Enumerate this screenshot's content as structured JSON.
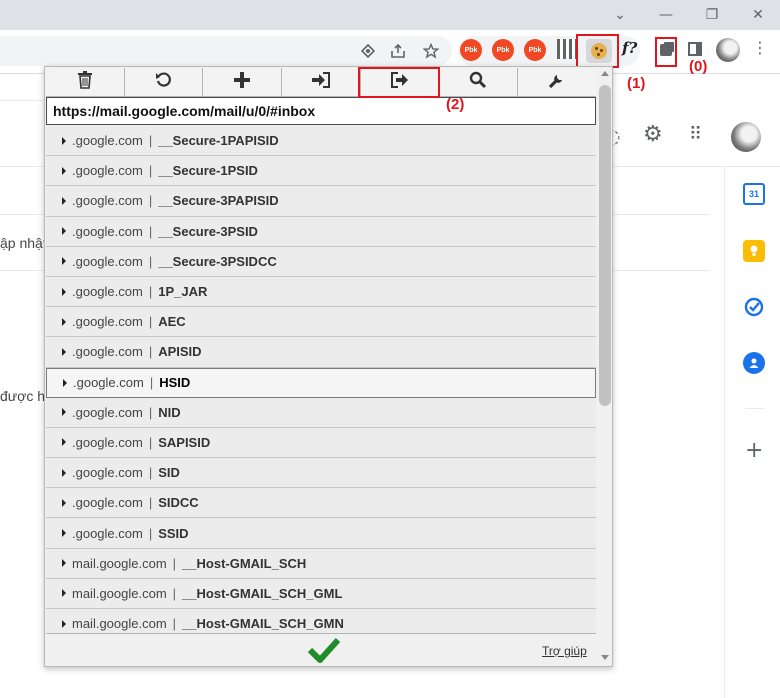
{
  "window_controls": {
    "tab_search": "⌄",
    "minimize": "—",
    "restore": "❐",
    "close": "✕"
  },
  "toolbar": {
    "extensions": [
      "Pbk",
      "Pbk",
      "Pbk"
    ],
    "fx_label": "f?",
    "more": "⋮"
  },
  "annotations": {
    "puzzle_label": "(0)",
    "cookie_label": "(1)",
    "export_label": "(2)",
    "color": "#e0151d"
  },
  "gmail_bg": {
    "text_update": "ập nhật",
    "text_allowed": "được h"
  },
  "popup": {
    "tools": [
      "trash-icon",
      "undo-icon",
      "plus-icon",
      "import-icon",
      "export-icon",
      "search-icon",
      "wrench-icon"
    ],
    "url": "https://mail.google.com/mail/u/0/#inbox",
    "cookies": [
      {
        "domain": ".google.com",
        "name": "__Secure-1PAPISID"
      },
      {
        "domain": ".google.com",
        "name": "__Secure-1PSID"
      },
      {
        "domain": ".google.com",
        "name": "__Secure-3PAPISID"
      },
      {
        "domain": ".google.com",
        "name": "__Secure-3PSID"
      },
      {
        "domain": ".google.com",
        "name": "__Secure-3PSIDCC"
      },
      {
        "domain": ".google.com",
        "name": "1P_JAR"
      },
      {
        "domain": ".google.com",
        "name": "AEC"
      },
      {
        "domain": ".google.com",
        "name": "APISID"
      },
      {
        "domain": ".google.com",
        "name": "HSID"
      },
      {
        "domain": ".google.com",
        "name": "NID"
      },
      {
        "domain": ".google.com",
        "name": "SAPISID"
      },
      {
        "domain": ".google.com",
        "name": "SID"
      },
      {
        "domain": ".google.com",
        "name": "SIDCC"
      },
      {
        "domain": ".google.com",
        "name": "SSID"
      },
      {
        "domain": "mail.google.com",
        "name": "__Host-GMAIL_SCH"
      },
      {
        "domain": "mail.google.com",
        "name": "__Host-GMAIL_SCH_GML"
      },
      {
        "domain": "mail.google.com",
        "name": "__Host-GMAIL_SCH_GMN"
      }
    ],
    "selected_cookie": "HSID",
    "separator": "|",
    "help": "Trợ giúp"
  }
}
